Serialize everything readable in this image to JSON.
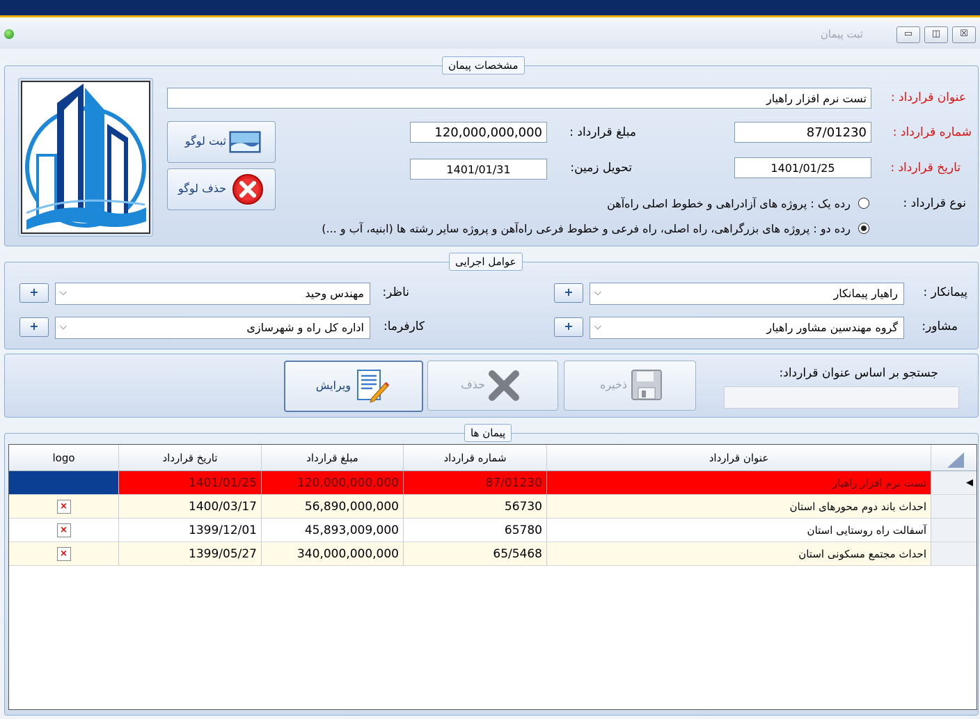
{
  "window": {
    "title": "ثبت پیمان",
    "controls": [
      "▭",
      "◫",
      "☒"
    ]
  },
  "contract_details": {
    "legend": "مشخصات پیمان",
    "title_label": "عنوان قرارداد :",
    "title_value": "تست نرم افزار راهیار",
    "number_label": "شماره قرارداد :",
    "number_value": "87/01230",
    "amount_label": "مبلغ قرارداد :",
    "amount_value": "120,000,000,000",
    "date_label": "تاریخ قرارداد :",
    "date_value": "1401/01/25",
    "land_label": "تحویل زمین:",
    "land_value": "1401/01/31",
    "type_label": "نوع قرارداد :",
    "type_option1": "رده یک : پروژه های آزادراهی و خطوط اصلی راه‌آهن",
    "type_option2": "رده دو : پروژه های بزرگراهی، راه اصلی، راه فرعی و خطوط فرعی راه‌آهن و پروژه سایر رشته ها (ابنیه، آب و ...)",
    "selected_type": 2,
    "logo_register": "ثبت لوگو",
    "logo_delete": "حذف لوگو"
  },
  "agents": {
    "legend": "عوامل اجرایی",
    "contractor_label": "پیمانکار :",
    "contractor_value": "راهیار پیمانکار",
    "supervisor_label": "ناظر:",
    "supervisor_value": "مهندس وحید",
    "consultant_label": "مشاور:",
    "consultant_value": "گروه مهندسین مشاور راهیار",
    "employer_label": "کارفرما:",
    "employer_value": "اداره کل راه و شهرسازی",
    "plus": "+",
    "dropdown": "⌵"
  },
  "actions": {
    "save": "ذخیره",
    "delete": "حذف",
    "edit": "ویرایش",
    "search_label": "جستجو بر اساس عنوان قرارداد:",
    "search_value": ""
  },
  "contracts": {
    "legend": "پیمان ها",
    "headers": {
      "title": "عنوان قرارداد",
      "number": "شماره قرارداد",
      "amount": "مبلغ قرارداد",
      "date": "تاریخ قرارداد",
      "logo": "logo"
    },
    "rows": [
      {
        "title": "تست نرم افزار راهیار",
        "number": "87/01230",
        "amount": "120,000,000,000",
        "date": "1401/01/25",
        "logo": ""
      },
      {
        "title": "احداث باند دوم محورهای استان",
        "number": "56730",
        "amount": "56,890,000,000",
        "date": "1400/03/17",
        "logo": "×"
      },
      {
        "title": "آسفالت راه روستایی استان",
        "number": "65780",
        "amount": "45,893,009,000",
        "date": "1399/12/01",
        "logo": "×"
      },
      {
        "title": "احداث مجتمع مسکونی استان",
        "number": "65/5468",
        "amount": "340,000,000,000",
        "date": "1399/05/27",
        "logo": "×"
      }
    ],
    "row_indicator": "◀",
    "colors": {
      "selected": "#ff0000",
      "odd": "#fffbe6",
      "even": "#ffffff"
    }
  }
}
